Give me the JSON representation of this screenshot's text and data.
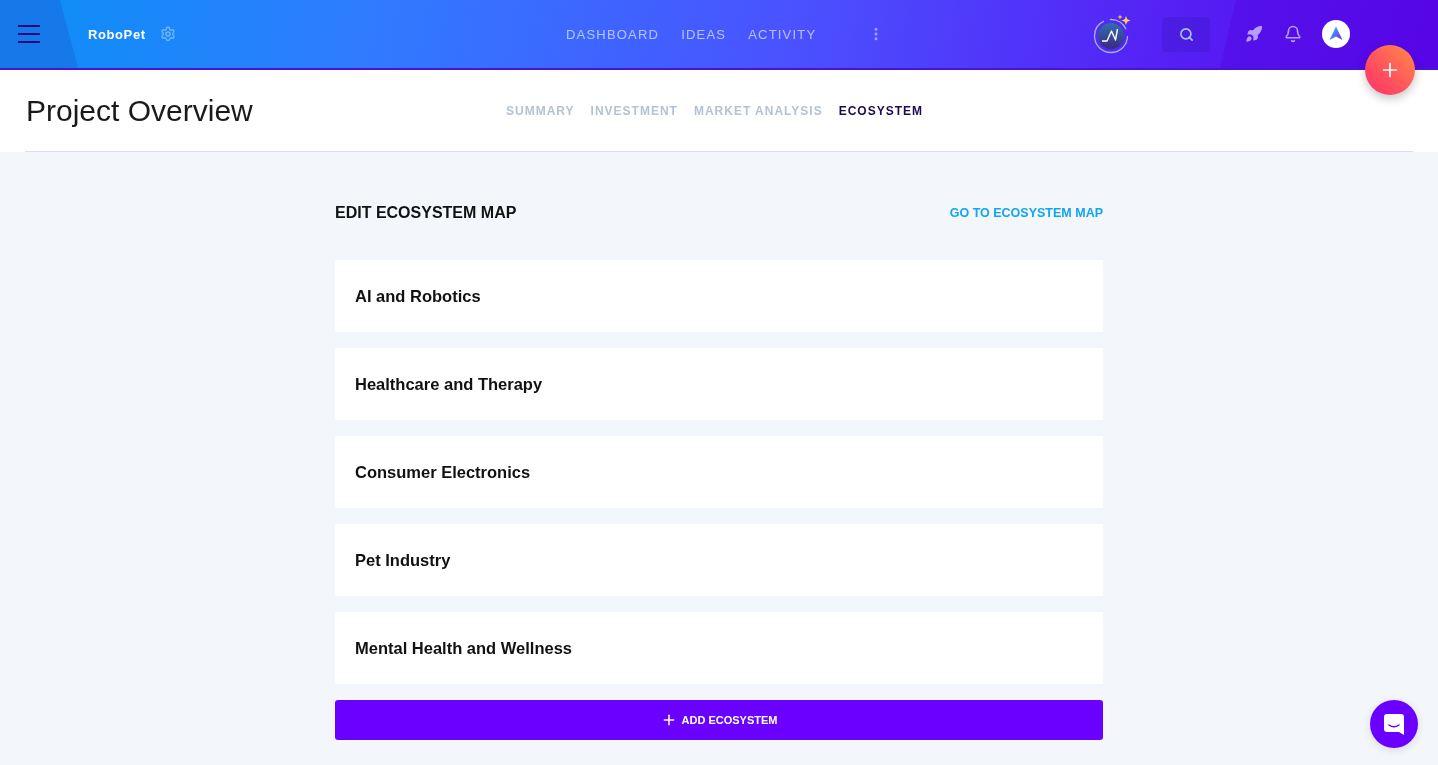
{
  "top_bar": {
    "project_name": "RoboPet",
    "nav": [
      {
        "label": "DASHBOARD"
      },
      {
        "label": "IDEAS"
      },
      {
        "label": "ACTIVITY"
      }
    ]
  },
  "header": {
    "title": "Project Overview",
    "tabs": [
      {
        "label": "SUMMARY",
        "selected": false
      },
      {
        "label": "INVESTMENT",
        "selected": false
      },
      {
        "label": "MARKET ANALYSIS",
        "selected": false
      },
      {
        "label": "ECOSYSTEM",
        "selected": true
      }
    ]
  },
  "ecosystem": {
    "title": "EDIT ECOSYSTEM MAP",
    "link": "GO TO ECOSYSTEM MAP",
    "items": [
      {
        "name": "AI and Robotics"
      },
      {
        "name": "Healthcare and Therapy"
      },
      {
        "name": "Consumer Electronics"
      },
      {
        "name": "Pet Industry"
      },
      {
        "name": "Mental Health and Wellness"
      }
    ],
    "add_button": "ADD ECOSYSTEM"
  }
}
